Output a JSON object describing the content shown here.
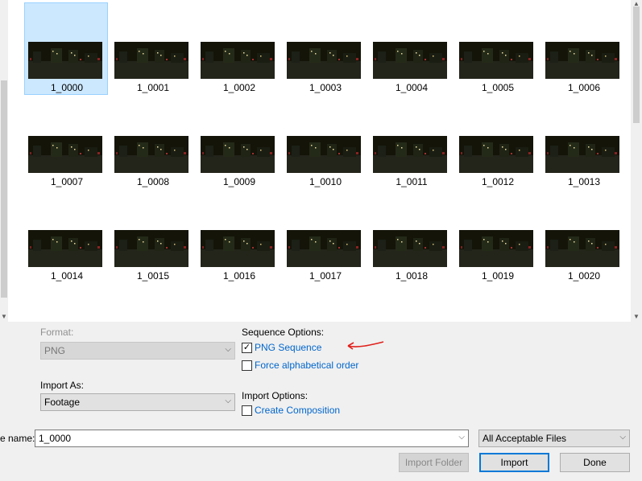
{
  "files": [
    "1_0000",
    "1_0001",
    "1_0002",
    "1_0003",
    "1_0004",
    "1_0005",
    "1_0006",
    "1_0007",
    "1_0008",
    "1_0009",
    "1_0010",
    "1_0011",
    "1_0012",
    "1_0013",
    "1_0014",
    "1_0015",
    "1_0016",
    "1_0017",
    "1_0018",
    "1_0019",
    "1_0020"
  ],
  "selected_file": "1_0000",
  "format": {
    "label": "Format:",
    "value": "PNG"
  },
  "import_as": {
    "label": "Import As:",
    "value": "Footage"
  },
  "sequence_options": {
    "label": "Sequence Options:",
    "png_sequence": {
      "label": "PNG Sequence",
      "checked": true
    },
    "force_alpha": {
      "label": "Force alphabetical order",
      "checked": false
    }
  },
  "import_options": {
    "label": "Import Options:",
    "create_comp": {
      "label": "Create Composition",
      "checked": false
    }
  },
  "filename": {
    "label": "e name:",
    "value": "1_0000"
  },
  "filetype": {
    "value": "All Acceptable Files"
  },
  "buttons": {
    "import_folder": "Import Folder",
    "import": "Import",
    "done": "Done"
  },
  "colors": {
    "selection": "#cce8ff",
    "link": "#0066cc",
    "annotation": "#e0201b"
  },
  "icons": {
    "check": "✓",
    "chevron": "⌵",
    "arrow_up": "▲",
    "arrow_down": "▼"
  }
}
